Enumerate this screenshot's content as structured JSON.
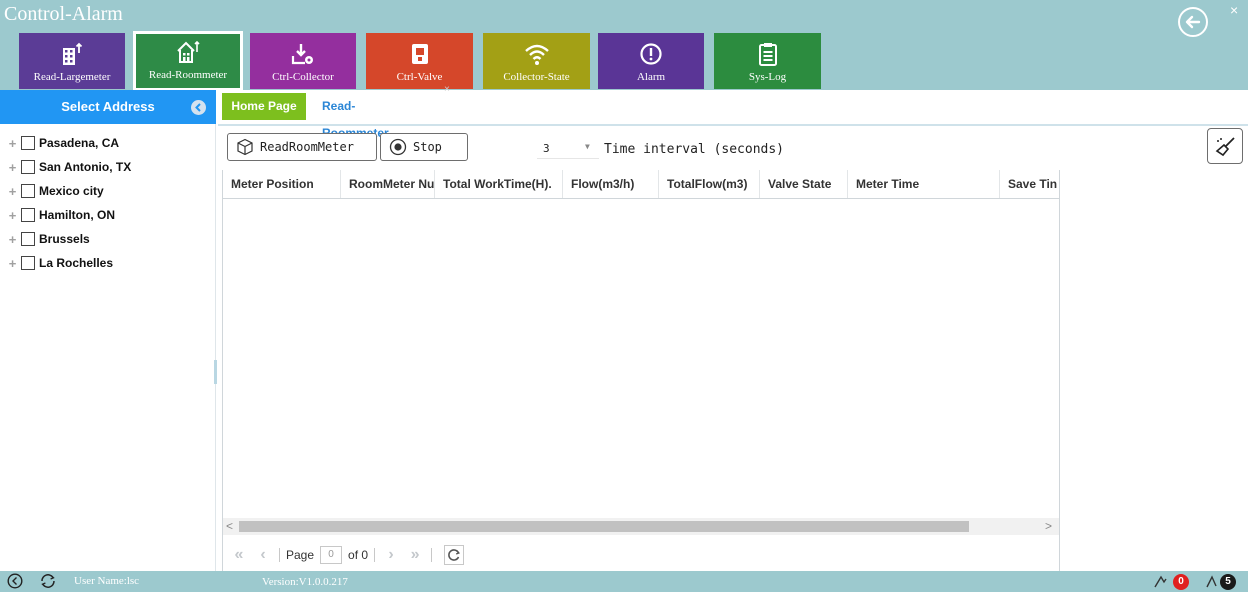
{
  "header": {
    "title": "Control-Alarm",
    "close": "×"
  },
  "toolbar": {
    "buttons": [
      {
        "label": "Read-Largemeter",
        "color": "#5b3c96",
        "icon": "building-arrow-icon"
      },
      {
        "label": "Read-Roommeter",
        "color": "#2e8b47",
        "icon": "house-arrow-icon"
      },
      {
        "label": "Ctrl-Collector",
        "color": "#942f9e",
        "icon": "download-gear-icon"
      },
      {
        "label": "Ctrl-Valve",
        "color": "#d5472a",
        "icon": "switch-icon"
      },
      {
        "label": "Collector-State",
        "color": "#a3a015",
        "icon": "wifi-icon"
      },
      {
        "label": "Alarm",
        "color": "#5a3596",
        "icon": "exclamation-circle-icon"
      },
      {
        "label": "Sys-Log",
        "color": "#2c8c3f",
        "icon": "clipboard-icon"
      }
    ],
    "active": "Read-Roommeter"
  },
  "sidebar": {
    "header": "Select Address",
    "tree": [
      {
        "label": "Pasadena, CA",
        "expander": "+"
      },
      {
        "label": "San Antonio, TX",
        "expander": "+"
      },
      {
        "label": "Mexico city",
        "expander": "+"
      },
      {
        "label": "Hamilton, ON",
        "expander": "+"
      },
      {
        "label": "Brussels",
        "expander": "+"
      },
      {
        "label": "La Rochelles",
        "expander": "+"
      }
    ]
  },
  "tabs": {
    "home": "Home Page",
    "current": "Read-Roommeter",
    "close": "×"
  },
  "actions": {
    "read_label": "ReadRoomMeter",
    "stop_label": "Stop",
    "interval_value": "3",
    "interval_label": "Time interval (seconds)"
  },
  "grid": {
    "columns": [
      "Meter Position",
      "RoomMeter Nu",
      "Total WorkTime(H).",
      "Flow(m3/h)",
      "TotalFlow(m3)",
      "Valve State",
      "Meter Time",
      "Save Tin"
    ],
    "rows": []
  },
  "pager": {
    "page_label": "Page",
    "page_value": "0",
    "of_label": "of 0"
  },
  "status": {
    "user": "User Name:lsc",
    "version": "Version:V1.0.0.217",
    "badge_red": "0",
    "badge_dark": "5",
    "badge_red_color": "#e02020",
    "badge_dark_color": "#1a1a1a"
  }
}
